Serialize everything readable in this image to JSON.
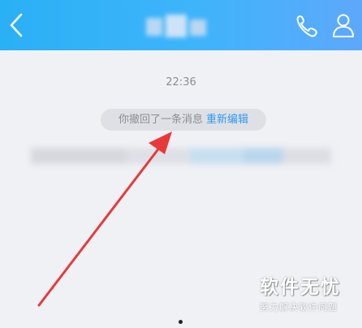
{
  "header": {
    "back_icon": "chevron-left-icon",
    "call_icon": "phone-icon",
    "profile_icon": "person-icon",
    "bg_color": "#3fb4fb"
  },
  "chat": {
    "timestamp": "22:36",
    "recall_notice": "你撤回了一条消息",
    "re_edit_link": "重新编辑",
    "link_color": "#2d9af0"
  },
  "annotation": {
    "arrow_color": "#e8393a"
  },
  "watermark": {
    "title": "软件无忧",
    "subtitle": "努力解决软件问题"
  }
}
